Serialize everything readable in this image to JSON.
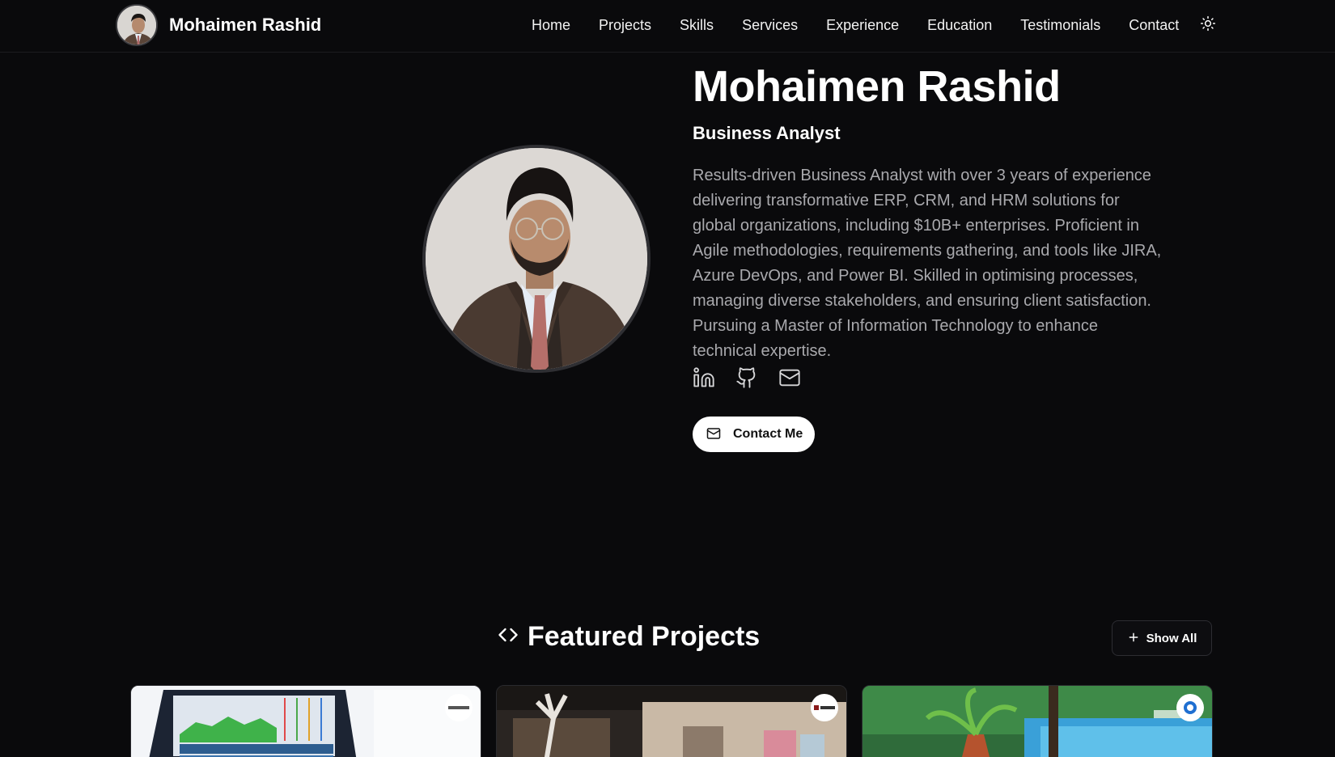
{
  "header": {
    "brand_name": "Mohaimen Rashid",
    "nav": [
      "Home",
      "Projects",
      "Skills",
      "Services",
      "Experience",
      "Education",
      "Testimonials",
      "Contact"
    ],
    "theme_icon": "sun-icon"
  },
  "hero": {
    "name": "Mohaimen Rashid",
    "role": "Business Analyst",
    "bio": "Results-driven Business Analyst with over 3 years of experience delivering transformative ERP, CRM, and HRM solutions for global organizations, including $10B+ enterprises. Proficient in Agile methodologies, requirements gathering, and tools like JIRA, Azure DevOps, and Power BI. Skilled in optimising processes, managing diverse stakeholders, and ensuring client satisfaction. Pursuing a Master of Information Technology to enhance technical expertise.",
    "socials": [
      "linkedin-icon",
      "github-icon",
      "mail-icon"
    ],
    "contact_button": "Contact Me"
  },
  "projects": {
    "title": "Featured Projects",
    "title_icon": "code-icon",
    "show_all": "Show All"
  },
  "colors": {
    "background": "#0a0a0c",
    "text": "#ffffff",
    "muted": "#a9a9ad",
    "button_bg": "#ffffff"
  }
}
